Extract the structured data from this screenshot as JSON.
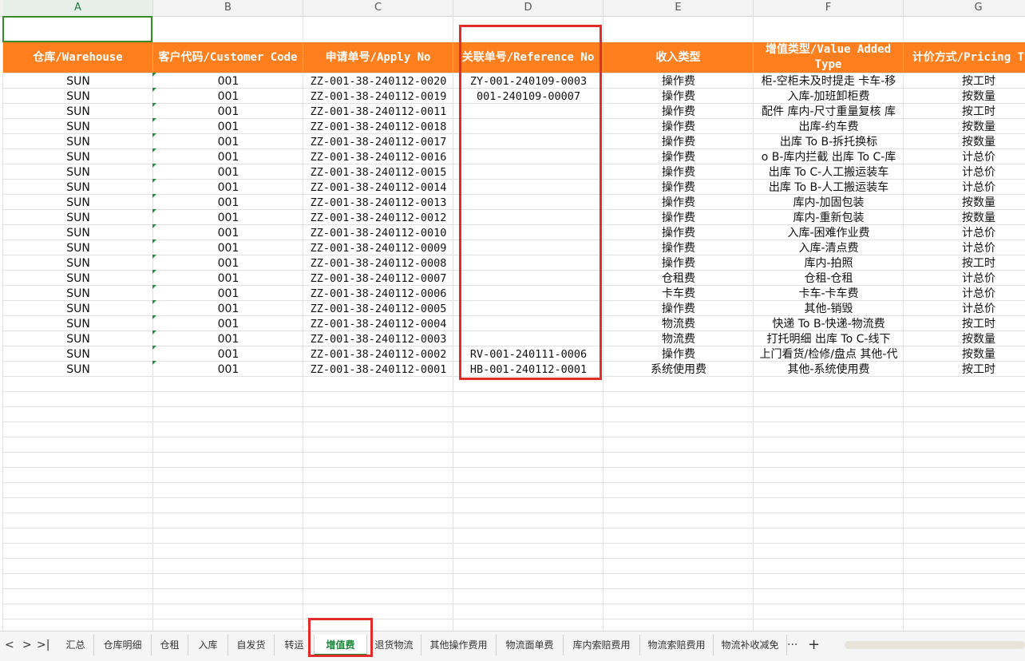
{
  "columns": [
    "A",
    "B",
    "C",
    "D",
    "E",
    "F",
    "G"
  ],
  "active_column": "A",
  "headers": {
    "a": "仓库/Warehouse",
    "b": "客户代码/Customer Code",
    "c": "申请单号/Apply No",
    "d": "关联单号/Reference No",
    "e": "收入类型",
    "f": "增值类型/Value Added Type",
    "g": "计价方式/Pricing Type"
  },
  "rows": [
    {
      "wh": "SUN",
      "cust": "001",
      "apply": "ZZ-001-38-240112-0020",
      "ref": "ZY-001-240109-0003",
      "income": "操作费",
      "vat": "柜-空柜未及时提走 卡车-移",
      "price": "按工时"
    },
    {
      "wh": "SUN",
      "cust": "001",
      "apply": "ZZ-001-38-240112-0019",
      "ref": "001-240109-00007",
      "income": "操作费",
      "vat": "入库-加班卸柜费",
      "price": "按数量"
    },
    {
      "wh": "SUN",
      "cust": "001",
      "apply": "ZZ-001-38-240112-0011",
      "ref": "",
      "income": "操作费",
      "vat": "配件 库内-尺寸重量复核 库",
      "price": "按工时"
    },
    {
      "wh": "SUN",
      "cust": "001",
      "apply": "ZZ-001-38-240112-0018",
      "ref": "",
      "income": "操作费",
      "vat": "出库-约车费",
      "price": "按数量"
    },
    {
      "wh": "SUN",
      "cust": "001",
      "apply": "ZZ-001-38-240112-0017",
      "ref": "",
      "income": "操作费",
      "vat": "出库 To B-拆托换标",
      "price": "按数量"
    },
    {
      "wh": "SUN",
      "cust": "001",
      "apply": "ZZ-001-38-240112-0016",
      "ref": "",
      "income": "操作费",
      "vat": "o B-库内拦截 出库 To C-库",
      "price": "计总价"
    },
    {
      "wh": "SUN",
      "cust": "001",
      "apply": "ZZ-001-38-240112-0015",
      "ref": "",
      "income": "操作费",
      "vat": "出库 To C-人工搬运装车",
      "price": "计总价"
    },
    {
      "wh": "SUN",
      "cust": "001",
      "apply": "ZZ-001-38-240112-0014",
      "ref": "",
      "income": "操作费",
      "vat": "出库 To B-人工搬运装车",
      "price": "计总价"
    },
    {
      "wh": "SUN",
      "cust": "001",
      "apply": "ZZ-001-38-240112-0013",
      "ref": "",
      "income": "操作费",
      "vat": "库内-加固包装",
      "price": "按数量"
    },
    {
      "wh": "SUN",
      "cust": "001",
      "apply": "ZZ-001-38-240112-0012",
      "ref": "",
      "income": "操作费",
      "vat": "库内-重新包装",
      "price": "按数量"
    },
    {
      "wh": "SUN",
      "cust": "001",
      "apply": "ZZ-001-38-240112-0010",
      "ref": "",
      "income": "操作费",
      "vat": "入库-困难作业费",
      "price": "计总价"
    },
    {
      "wh": "SUN",
      "cust": "001",
      "apply": "ZZ-001-38-240112-0009",
      "ref": "",
      "income": "操作费",
      "vat": "入库-清点费",
      "price": "计总价"
    },
    {
      "wh": "SUN",
      "cust": "001",
      "apply": "ZZ-001-38-240112-0008",
      "ref": "",
      "income": "操作费",
      "vat": "库内-拍照",
      "price": "按工时"
    },
    {
      "wh": "SUN",
      "cust": "001",
      "apply": "ZZ-001-38-240112-0007",
      "ref": "",
      "income": "仓租费",
      "vat": "仓租-仓租",
      "price": "计总价"
    },
    {
      "wh": "SUN",
      "cust": "001",
      "apply": "ZZ-001-38-240112-0006",
      "ref": "",
      "income": "卡车费",
      "vat": "卡车-卡车费",
      "price": "计总价"
    },
    {
      "wh": "SUN",
      "cust": "001",
      "apply": "ZZ-001-38-240112-0005",
      "ref": "",
      "income": "操作费",
      "vat": "其他-销毁",
      "price": "计总价"
    },
    {
      "wh": "SUN",
      "cust": "001",
      "apply": "ZZ-001-38-240112-0004",
      "ref": "",
      "income": "物流费",
      "vat": "快递 To B-快递-物流费",
      "price": "按工时"
    },
    {
      "wh": "SUN",
      "cust": "001",
      "apply": "ZZ-001-38-240112-0003",
      "ref": "",
      "income": "物流费",
      "vat": "打托明细 出库 To C-线下",
      "price": "按数量"
    },
    {
      "wh": "SUN",
      "cust": "001",
      "apply": "ZZ-001-38-240112-0002",
      "ref": "RV-001-240111-0006",
      "income": "操作费",
      "vat": "上门看货/检修/盘点 其他-代",
      "price": "按数量"
    },
    {
      "wh": "SUN",
      "cust": "001",
      "apply": "ZZ-001-38-240112-0001",
      "ref": "HB-001-240112-0001",
      "income": "系统使用费",
      "vat": "其他-系统使用费",
      "price": "按工时"
    }
  ],
  "tabs": [
    "汇总",
    "仓库明细",
    "仓租",
    "入库",
    "自发货",
    "转运",
    "增值费",
    "退货物流",
    "其他操作费用",
    "物流面单费",
    "库内索赔费用",
    "物流索赔费用",
    "物流补收减免"
  ],
  "active_tab": "增值费",
  "nav": {
    "prev": "<",
    "next": ">",
    "last": ">|",
    "more": "···",
    "add": "+"
  },
  "colors": {
    "header_orange": "#ff7f1f",
    "highlight_red": "#e22b2b",
    "active_green": "#1a8a3a"
  }
}
